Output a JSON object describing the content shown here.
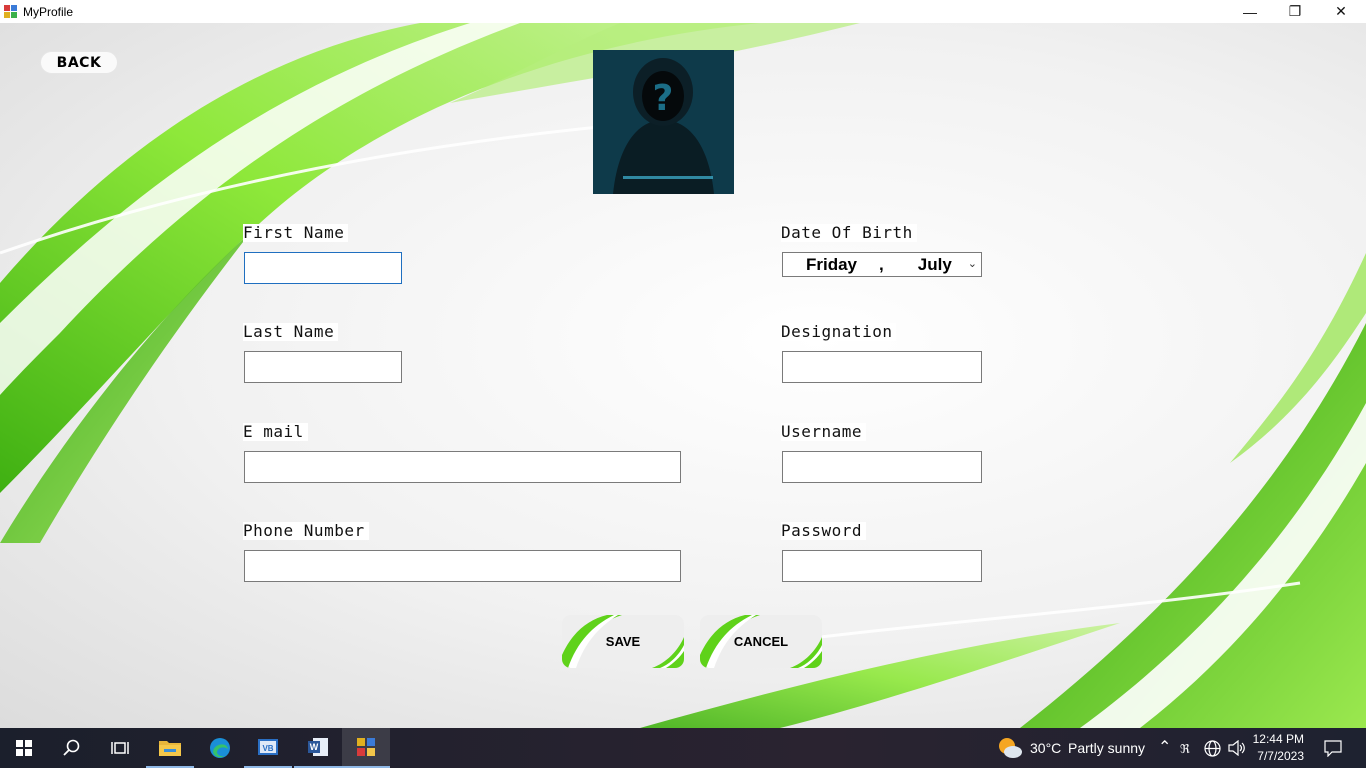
{
  "window": {
    "title": "MyProfile",
    "controls": {
      "minimize": "—",
      "restore": "❐",
      "close": "✕"
    }
  },
  "nav": {
    "back_label": "BACK"
  },
  "form": {
    "first_name": {
      "label": "First Name",
      "value": ""
    },
    "last_name": {
      "label": "Last Name",
      "value": ""
    },
    "email": {
      "label": "E mail",
      "value": ""
    },
    "phone": {
      "label": "Phone Number",
      "value": ""
    },
    "dob": {
      "label": "Date Of Birth",
      "day": "Friday",
      "separator": ",",
      "month": "July"
    },
    "designation": {
      "label": "Designation",
      "value": ""
    },
    "username": {
      "label": "Username",
      "value": ""
    },
    "password": {
      "label": "Password",
      "value": ""
    }
  },
  "actions": {
    "save_label": "SAVE",
    "cancel_label": "CANCEL"
  },
  "taskbar": {
    "weather": {
      "temp": "30°C",
      "condition": "Partly sunny"
    },
    "time": "12:44 PM",
    "date": "7/7/2023"
  },
  "colors": {
    "accent_green": "#5fd21a",
    "taskbar": "#1f2230",
    "focus_border": "#1f6fc0"
  }
}
